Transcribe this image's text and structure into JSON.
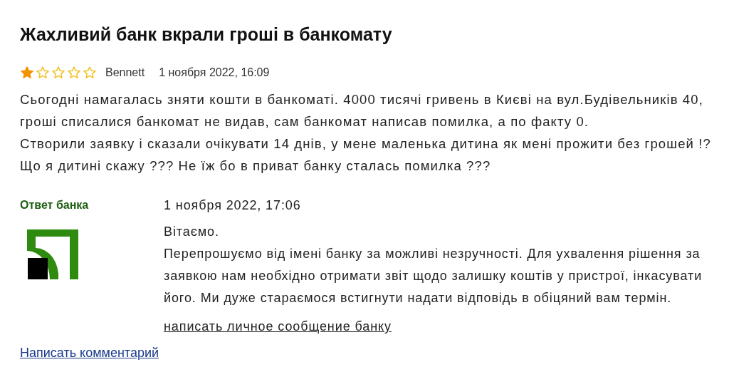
{
  "review": {
    "title": "Жахливий банк вкрали гроші в банкомату",
    "stars": 1,
    "author": "Bennett",
    "date": "1 ноября 2022, 16:09",
    "body_lines": [
      "Сьогодні намагалась зняти кошти в банкоматі. 4000 тисячі гривень в Києві на вул.Будівельників 40,",
      "гроші списалися банкомат не видав, сам банкомат написав помилка, а по факту 0.",
      "Створили заявку і сказали очікувати 14 днів, у мене маленька дитина як мені прожити без грошей !?",
      "Що я дитині скажу ??? Не їж бо в приват банку сталась помилка ???"
    ]
  },
  "bank_reply": {
    "label": "Ответ банка",
    "date": "1 ноября 2022, 17:06",
    "greeting": "Вітаємо.",
    "body_lines": [
      "Перепрошуємо від імені банку за можливі незручності. Для ухвалення рішення за",
      "заявкою нам необхідно отримати звіт щодо залишку коштів у пристрої, інкасувати",
      "його. Ми дуже стараємося встигнути надати відповідь в обіцяний вам термін."
    ],
    "message_link": "написать личное сообщение банку"
  },
  "comment_link": "Написать комментарий"
}
